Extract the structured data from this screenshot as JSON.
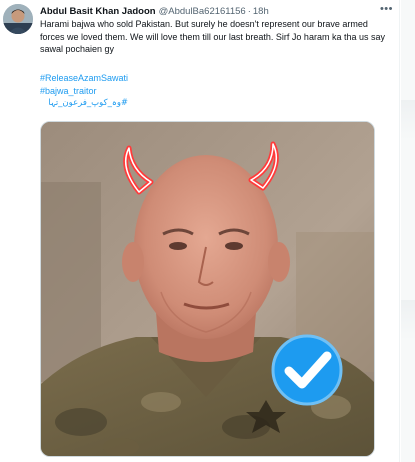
{
  "tweet": {
    "author_name": "Abdul Basit Khan Jadoon",
    "author_handle": "@AbdulBa62161156",
    "separator": "·",
    "time": "18h",
    "more_icon": "more-horizontal-icon",
    "text": "Harami bajwa who sold Pakistan. But surely he doesn't represent our brave armed forces we loved them. We will love them till our last breath. Sirf Jo haram ka tha us say sawal pochaien gy",
    "hashtags": [
      "#ReleaseAzamSawati",
      "#bajwa_traitor",
      "#وہ_کوپ_فرعون_تہا"
    ],
    "media": {
      "kind": "photo",
      "overlay_icons": [
        "devil-horns-icon",
        "verified-check-icon"
      ]
    }
  },
  "colors": {
    "link": "#1d9bf0",
    "text": "#0f1419",
    "muted": "#536471",
    "verified": "#1d9bf0"
  }
}
